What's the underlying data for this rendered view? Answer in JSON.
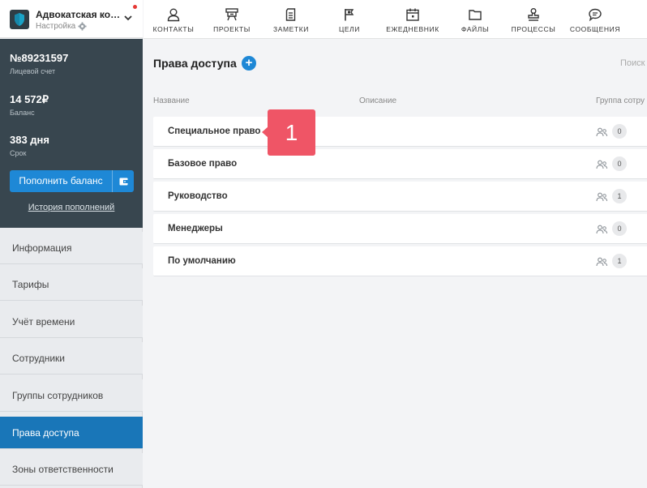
{
  "org": {
    "name": "Адвокатская кон...",
    "subtitle": "Настройка"
  },
  "account": {
    "number": "№89231597",
    "number_label": "Лицевой счет",
    "balance": "14 572₽",
    "balance_label": "Баланс",
    "term": "383 дня",
    "term_label": "Срок",
    "topup_label": "Пополнить баланс",
    "history_label": "История пополнений"
  },
  "sidebar": {
    "items": [
      {
        "label": "Информация"
      },
      {
        "label": "Тарифы"
      },
      {
        "label": "Учёт времени"
      },
      {
        "label": "Сотрудники"
      },
      {
        "label": "Группы сотрудников"
      },
      {
        "label": "Права доступа",
        "active": true
      },
      {
        "label": "Зоны ответственности"
      }
    ]
  },
  "topnav": {
    "items": [
      {
        "label": "КОНТАКТЫ",
        "icon": "person-icon"
      },
      {
        "label": "ПРОЕКТЫ",
        "icon": "projects-icon"
      },
      {
        "label": "ЗАМЕТКИ",
        "icon": "notes-icon"
      },
      {
        "label": "ЦЕЛИ",
        "icon": "flag-icon"
      },
      {
        "label": "ЕЖЕДНЕВНИК",
        "icon": "calendar-icon"
      },
      {
        "label": "ФАЙЛЫ",
        "icon": "folder-icon"
      },
      {
        "label": "ПРОЦЕССЫ",
        "icon": "stamp-icon"
      },
      {
        "label": "СООБЩЕНИЯ",
        "icon": "chat-icon"
      }
    ]
  },
  "main": {
    "title": "Права доступа",
    "add_symbol": "+",
    "search_placeholder": "Поиск",
    "columns": {
      "name": "Название",
      "description": "Описание",
      "group": "Группа сотру"
    },
    "rows": [
      {
        "name": "Специальное право",
        "count": "0"
      },
      {
        "name": "Базовое право",
        "count": "0"
      },
      {
        "name": "Руководство",
        "count": "1"
      },
      {
        "name": "Менеджеры",
        "count": "0"
      },
      {
        "name": "По умолчанию",
        "count": "1"
      }
    ]
  },
  "callout": {
    "text": "1"
  },
  "colors": {
    "accent": "#1e88d6",
    "sidebar_dark": "#38464f",
    "active_nav": "#1976b8",
    "callout": "#ef5566"
  }
}
